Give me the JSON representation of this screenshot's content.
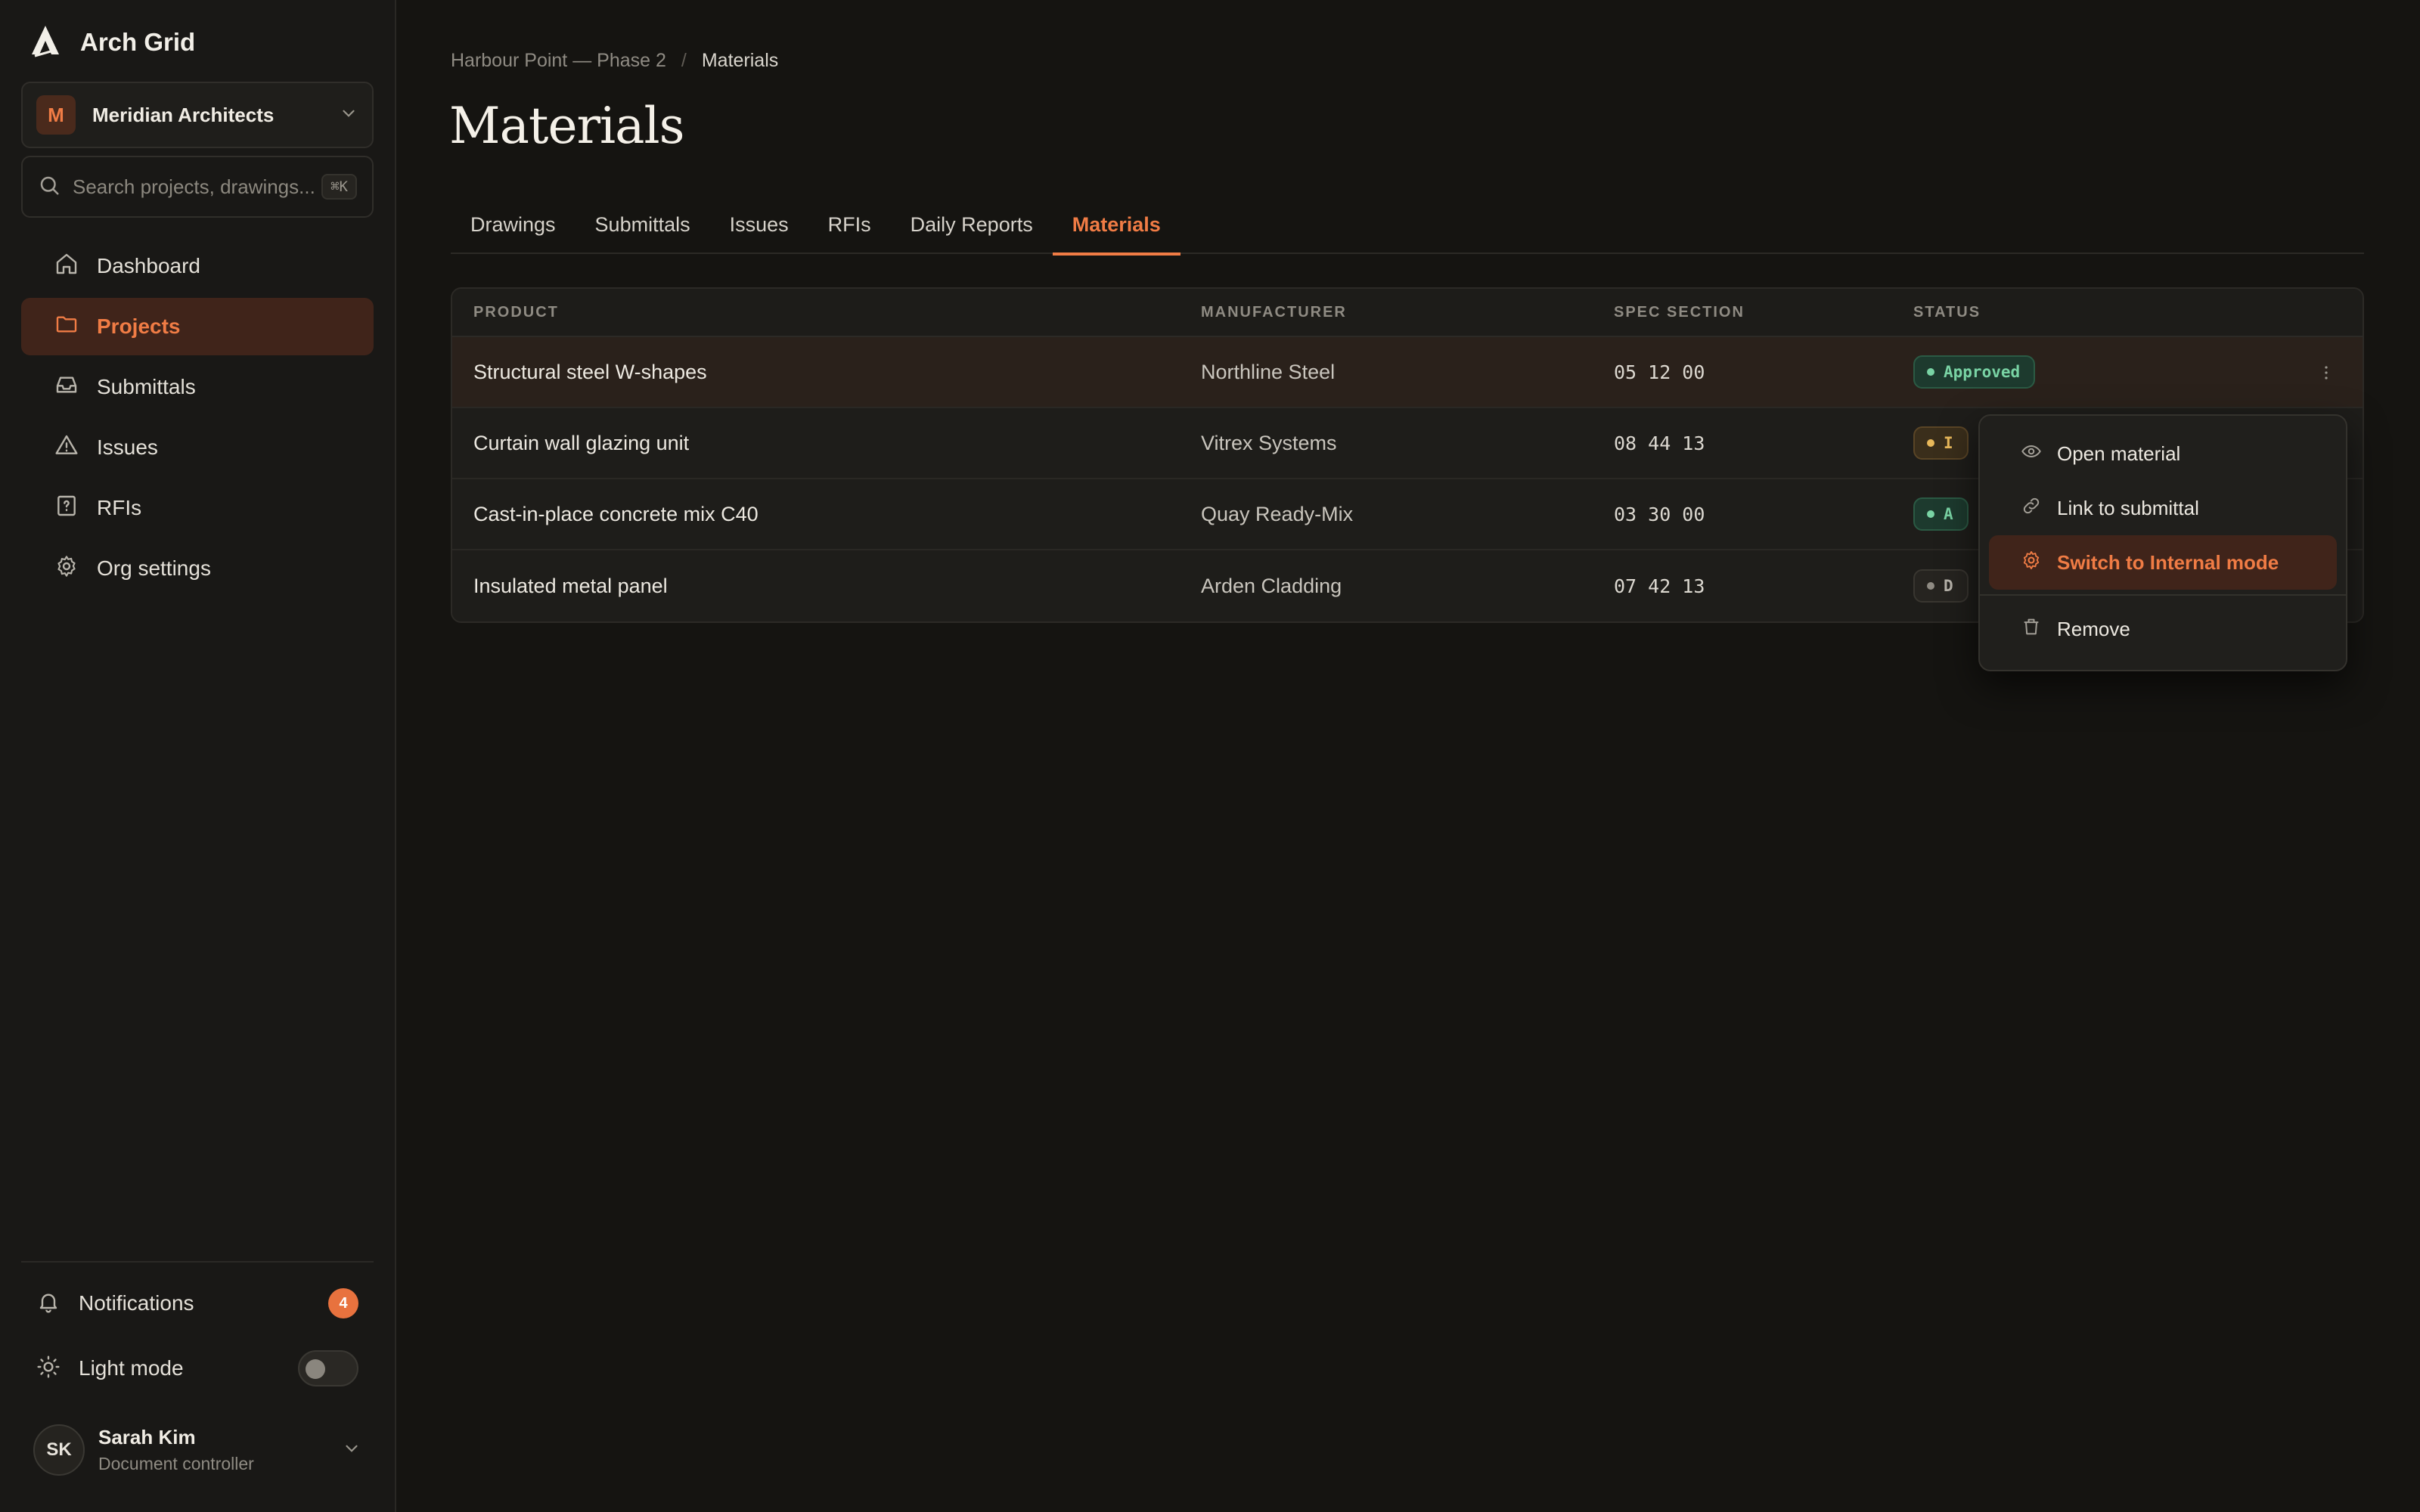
{
  "brand": {
    "name": "Arch Grid"
  },
  "org": {
    "initial": "M",
    "name": "Meridian Architects"
  },
  "search": {
    "placeholder": "Search projects, drawings...",
    "shortcut": "⌘K"
  },
  "nav": [
    {
      "label": "Dashboard",
      "icon": "home-icon",
      "active": false
    },
    {
      "label": "Projects",
      "icon": "folder-icon",
      "active": true
    },
    {
      "label": "Submittals",
      "icon": "inbox-icon",
      "active": false
    },
    {
      "label": "Issues",
      "icon": "alert-triangle-icon",
      "active": false
    },
    {
      "label": "RFIs",
      "icon": "question-file-icon",
      "active": false
    },
    {
      "label": "Org settings",
      "icon": "gear-icon",
      "active": false
    }
  ],
  "notifications": {
    "label": "Notifications",
    "count": "4"
  },
  "light_mode": {
    "label": "Light mode",
    "enabled": false
  },
  "user": {
    "initials": "SK",
    "name": "Sarah Kim",
    "role": "Document controller"
  },
  "breadcrumb": {
    "project": "Harbour Point — Phase 2",
    "separator": "/",
    "current": "Materials"
  },
  "page_title": "Materials",
  "tabs": [
    "Drawings",
    "Submittals",
    "Issues",
    "RFIs",
    "Daily Reports",
    "Materials"
  ],
  "active_tab": "Materials",
  "table": {
    "headers": [
      "PRODUCT",
      "MANUFACTURER",
      "SPEC SECTION",
      "STATUS"
    ],
    "rows": [
      {
        "product": "Structural steel W-shapes",
        "manufacturer": "Northline Steel",
        "spec": "05 12 00",
        "status": "Approved",
        "status_visible": "Approved"
      },
      {
        "product": "Curtain wall glazing unit",
        "manufacturer": "Vitrex Systems",
        "spec": "08 44 13",
        "status": "In review",
        "status_visible": "I"
      },
      {
        "product": "Cast-in-place concrete mix C40",
        "manufacturer": "Quay Ready-Mix",
        "spec": "03 30 00",
        "status": "Approved",
        "status_visible": "A"
      },
      {
        "product": "Insulated metal panel",
        "manufacturer": "Arden Cladding",
        "spec": "07 42 13",
        "status": "Draft",
        "status_visible": "D"
      }
    ]
  },
  "context_menu": {
    "items": [
      {
        "label": "Open material",
        "icon": "eye-icon"
      },
      {
        "label": "Link to submittal",
        "icon": "link-icon"
      },
      {
        "label": "Switch to Internal mode",
        "icon": "gear-icon",
        "highlighted": true
      },
      {
        "label": "Remove",
        "icon": "trash-icon"
      }
    ]
  },
  "colors": {
    "accent": "#f07c45",
    "background": "#151411",
    "sidebar": "#191816",
    "approved": "#79d3a4",
    "review": "#e8b85a"
  }
}
